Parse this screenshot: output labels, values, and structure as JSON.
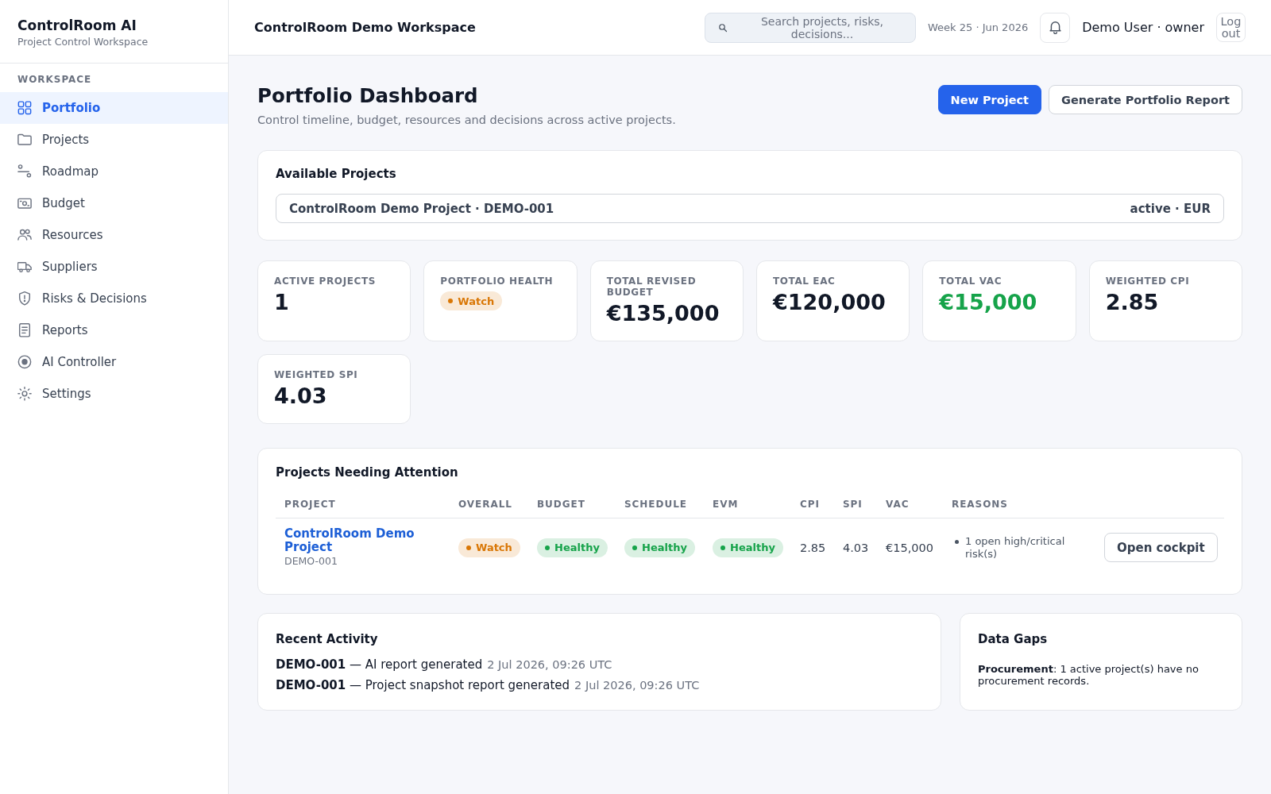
{
  "sidebar": {
    "brand": "ControlRoom AI",
    "subtitle": "Project Control Workspace",
    "section_label": "WORKSPACE",
    "items": [
      {
        "label": "Portfolio",
        "selected": true
      },
      {
        "label": "Projects",
        "selected": false
      },
      {
        "label": "Roadmap",
        "selected": false
      },
      {
        "label": "Budget",
        "selected": false
      },
      {
        "label": "Resources",
        "selected": false
      },
      {
        "label": "Suppliers",
        "selected": false
      },
      {
        "label": "Risks & Decisions",
        "selected": false
      },
      {
        "label": "Reports",
        "selected": false
      },
      {
        "label": "AI Controller",
        "selected": false
      },
      {
        "label": "Settings",
        "selected": false
      }
    ]
  },
  "top_bar": {
    "title": "ControlRoom Demo Workspace",
    "search": {
      "placeholder": "Search projects, risks, decisions..."
    },
    "week": "Week 25 · Jun 2026",
    "user": "Demo User · owner",
    "logout": "Log out"
  },
  "header": {
    "title": "Portfolio Dashboard",
    "subtitle": "Control timeline, budget, resources and decisions across active projects.",
    "buttons": [
      {
        "label": "New Project",
        "kind": "primary"
      },
      {
        "label": "Generate Portfolio Report",
        "kind": "secondary"
      }
    ]
  },
  "available_projects": {
    "title": "Available Projects",
    "items": [
      {
        "name": "ControlRoom Demo Project · DEMO-001",
        "meta": "active · EUR"
      }
    ]
  },
  "kpis": [
    {
      "label": "ACTIVE PROJECTS",
      "kind": "value",
      "value": "1",
      "positive": false
    },
    {
      "label": "PORTFOLIO HEALTH",
      "kind": "badge",
      "value": "Watch",
      "color": "#d97706"
    },
    {
      "label": "TOTAL REVISED BUDGET",
      "kind": "value",
      "value": "€135,000",
      "positive": false
    },
    {
      "label": "TOTAL EAC",
      "kind": "value",
      "value": "€120,000",
      "positive": false
    },
    {
      "label": "TOTAL VAC",
      "kind": "value",
      "value": "€15,000",
      "positive": true
    },
    {
      "label": "WEIGHTED CPI",
      "kind": "value",
      "value": "2.85",
      "positive": false
    },
    {
      "label": "WEIGHTED SPI",
      "kind": "value",
      "value": "4.03",
      "positive": false
    }
  ],
  "attention": {
    "title": "Projects Needing Attention",
    "columns": [
      "PROJECT",
      "OVERALL",
      "BUDGET",
      "SCHEDULE",
      "EVM",
      "CPI",
      "SPI",
      "VAC",
      "REASONS"
    ],
    "rows": [
      {
        "project": {
          "name": "ControlRoom Demo Project",
          "code": "DEMO-001"
        },
        "overall": {
          "label": "Watch",
          "color": "#d97706"
        },
        "budget": {
          "label": "Healthy",
          "color": "#16a34a"
        },
        "schedule": {
          "label": "Healthy",
          "color": "#16a34a"
        },
        "evm": {
          "label": "Healthy",
          "color": "#16a34a"
        },
        "cpi": "2.85",
        "spi": "4.03",
        "vac": "€15,000",
        "reasons": [
          "1 open high/critical risk(s)"
        ],
        "action": "Open cockpit"
      }
    ]
  },
  "recent_activity": {
    "title": "Recent Activity",
    "items": [
      {
        "text": "**DEMO-001** — AI report generated",
        "time": "2 Jul 2026, 09:26 UTC"
      },
      {
        "text": "**DEMO-001** — Project snapshot report generated",
        "time": "2 Jul 2026, 09:26 UTC"
      }
    ]
  },
  "data_gaps": {
    "title": "Data Gaps",
    "items": [
      "**Procurement**: 1 active project(s) have no procurement records."
    ]
  }
}
